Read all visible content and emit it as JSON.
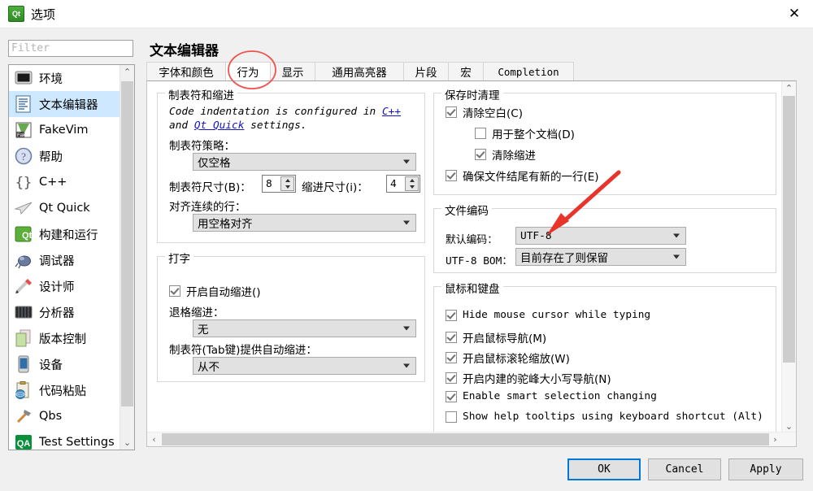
{
  "window": {
    "title": "选项",
    "icon": "qt-logo-icon",
    "close_label": "✕"
  },
  "sidebar": {
    "filter_placeholder": "Filter",
    "filter_value": "",
    "items": [
      {
        "label": "环境",
        "icon": "monitor-icon",
        "selected": false
      },
      {
        "label": "文本编辑器",
        "icon": "text-editor-icon",
        "selected": true
      },
      {
        "label": "FakeVim",
        "icon": "fakevim-icon",
        "selected": false
      },
      {
        "label": "帮助",
        "icon": "help-icon",
        "selected": false
      },
      {
        "label": "C++",
        "icon": "braces-icon",
        "selected": false
      },
      {
        "label": "Qt Quick",
        "icon": "paper-plane-icon",
        "selected": false
      },
      {
        "label": "构建和运行",
        "icon": "qt-build-icon",
        "selected": false
      },
      {
        "label": "调试器",
        "icon": "bug-icon",
        "selected": false
      },
      {
        "label": "设计师",
        "icon": "designer-icon",
        "selected": false
      },
      {
        "label": "分析器",
        "icon": "analyzer-icon",
        "selected": false
      },
      {
        "label": "版本控制",
        "icon": "version-control-icon",
        "selected": false
      },
      {
        "label": "设备",
        "icon": "device-icon",
        "selected": false
      },
      {
        "label": "代码粘贴",
        "icon": "code-paste-icon",
        "selected": false
      },
      {
        "label": "Qbs",
        "icon": "hammer-icon",
        "selected": false
      },
      {
        "label": "Test Settings",
        "icon": "qa-icon",
        "selected": false
      }
    ],
    "scroll_up": "⌃",
    "scroll_down": "⌄"
  },
  "page": {
    "title": "文本编辑器",
    "tabs": [
      {
        "label": "字体和颜色",
        "active": false,
        "mono": false
      },
      {
        "label": "行为",
        "active": true,
        "mono": false
      },
      {
        "label": "显示",
        "active": false,
        "mono": false
      },
      {
        "label": "通用高亮器",
        "active": false,
        "mono": false
      },
      {
        "label": "片段",
        "active": false,
        "mono": false
      },
      {
        "label": "宏",
        "active": false,
        "mono": false
      },
      {
        "label": "Completion",
        "active": false,
        "mono": true
      }
    ]
  },
  "tabs_indent": {
    "title": "制表符和缩进",
    "info_line1_pre": "Code indentation is configured in ",
    "info_link1": "C++",
    "info_line2_pre": "and ",
    "info_link2": "Qt Quick",
    "info_line2_post": " settings.",
    "tab_policy_label": "制表符策略：",
    "tab_policy_value": "仅空格",
    "tab_size_label": "制表符尺寸(B)：",
    "tab_size_value": "8",
    "indent_size_label": "缩进尺寸(i)：",
    "indent_size_value": "4",
    "align_label": "对齐连续的行：",
    "align_value": "用空格对齐"
  },
  "typing": {
    "title": "打字",
    "auto_indent_label": "开启自动缩进()",
    "auto_indent_checked": true,
    "backspace_label": "退格缩进：",
    "backspace_value": "无",
    "tab_key_label": "制表符(Tab键)提供自动缩进：",
    "tab_key_value": "从不"
  },
  "cleanup": {
    "title": "保存时清理",
    "items": [
      {
        "label": "清除空白(C)",
        "checked": true,
        "indent": 0
      },
      {
        "label": "用于整个文档(D)",
        "checked": false,
        "indent": 1
      },
      {
        "label": "清除缩进",
        "checked": true,
        "indent": 1
      },
      {
        "label": "确保文件结尾有新的一行(E)",
        "checked": true,
        "indent": 0
      }
    ]
  },
  "encoding": {
    "title": "文件编码",
    "default_label": "默认编码：",
    "default_value": "UTF-8",
    "bom_label": "UTF-8 BOM：",
    "bom_value": "目前存在了则保留"
  },
  "mouse_keyboard": {
    "title": "鼠标和键盘",
    "items": [
      {
        "label": "Hide mouse cursor while typing",
        "checked": true,
        "mono": true
      },
      {
        "label": "开启鼠标导航(M)",
        "checked": true,
        "mono": false
      },
      {
        "label": "开启鼠标滚轮缩放(W)",
        "checked": true,
        "mono": false
      },
      {
        "label": "开启内建的驼峰大小写导航(N)",
        "checked": true,
        "mono": false
      },
      {
        "label": "Enable smart selection changing",
        "checked": true,
        "mono": true
      },
      {
        "label": "Show help tooltips using keyboard shortcut (Alt)",
        "checked": false,
        "mono": true
      }
    ]
  },
  "scrollbars": {
    "up": "⌃",
    "down": "⌄",
    "left": "‹",
    "right": "›"
  },
  "footer": {
    "ok": "OK",
    "cancel": "Cancel",
    "apply": "Apply"
  },
  "annotations": {
    "color": "#e8342a",
    "circle_target": "行为",
    "arrow_target": "默认编码"
  }
}
